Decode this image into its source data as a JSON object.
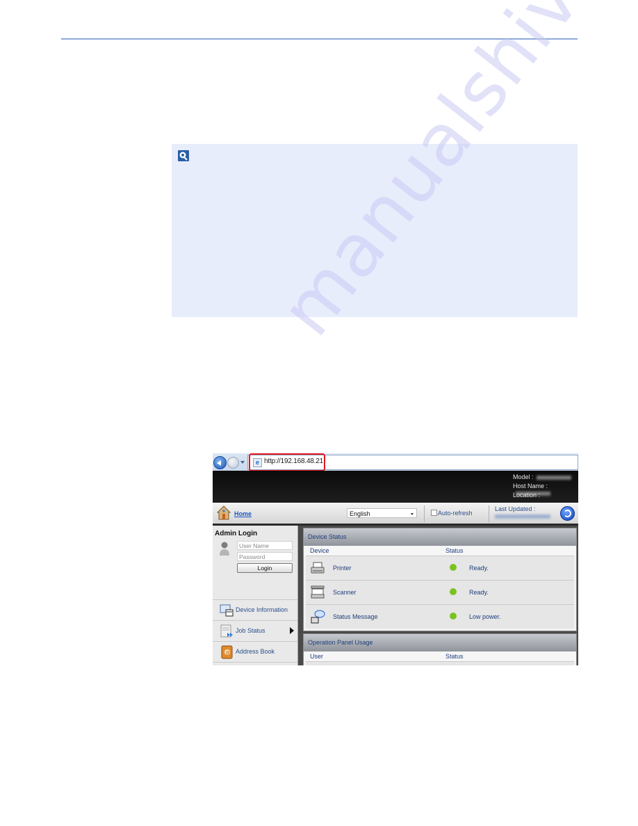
{
  "note": {
    "icon": "note-hint-icon"
  },
  "watermark": "manualshive.com",
  "browser": {
    "url": "http://192.168.48.21"
  },
  "header": {
    "model_label": "Model :",
    "host_label": "Host Name :",
    "location_label": "Location :"
  },
  "toolbar": {
    "home_label": "Home",
    "language": "English",
    "auto_refresh_label": "Auto-refresh",
    "last_updated_label": "Last Updated :"
  },
  "sidebar": {
    "login_title": "Admin Login",
    "username_placeholder": "User Name",
    "password_placeholder": "Password",
    "login_button": "Login",
    "items": [
      {
        "label": "Device Information",
        "icon": "device-info-icon"
      },
      {
        "label": "Job Status",
        "icon": "job-status-icon",
        "has_submenu": true
      },
      {
        "label": "Address Book",
        "icon": "address-book-icon"
      }
    ]
  },
  "device_status": {
    "title": "Device Status",
    "columns": [
      "Device",
      "Status"
    ],
    "rows": [
      {
        "device": "Printer",
        "status": "Ready.",
        "indicator": "#7cc21e"
      },
      {
        "device": "Scanner",
        "status": "Ready.",
        "indicator": "#7cc21e"
      },
      {
        "device": "Status Message",
        "status": "Low power.",
        "indicator": "#7cc21e"
      }
    ]
  },
  "panel_usage": {
    "title": "Operation Panel Usage",
    "columns": [
      "User",
      "Status"
    ]
  }
}
